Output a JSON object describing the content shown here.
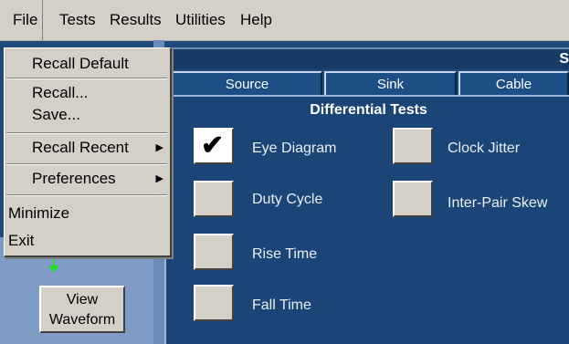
{
  "menubar": {
    "items": [
      "File",
      "Tests",
      "Results",
      "Utilities",
      "Help"
    ]
  },
  "title_fragment": "S",
  "tabs": [
    "Source",
    "Sink",
    "Cable"
  ],
  "section_title": "Differential Tests",
  "tests": [
    {
      "label": "Eye Diagram",
      "checked": true
    },
    {
      "label": "Duty Cycle",
      "checked": false
    },
    {
      "label": "Rise Time",
      "checked": false
    },
    {
      "label": "Fall Time",
      "checked": false
    },
    {
      "label": "Clock Jitter",
      "checked": false
    },
    {
      "label": "Inter-Pair Skew",
      "checked": false
    }
  ],
  "check_mark": "✔",
  "view_waveform": [
    "View",
    "Waveform"
  ],
  "file_menu": {
    "items": [
      {
        "label": "Recall Default",
        "submenu": false
      },
      {
        "label": "Recall...",
        "submenu": false
      },
      {
        "label": "Save...",
        "submenu": false
      },
      {
        "label": "Recall Recent",
        "submenu": true
      },
      {
        "label": "Preferences",
        "submenu": true
      },
      {
        "label": "Minimize",
        "submenu": false
      },
      {
        "label": "Exit",
        "submenu": false
      }
    ],
    "submenu_arrow": "▶"
  }
}
